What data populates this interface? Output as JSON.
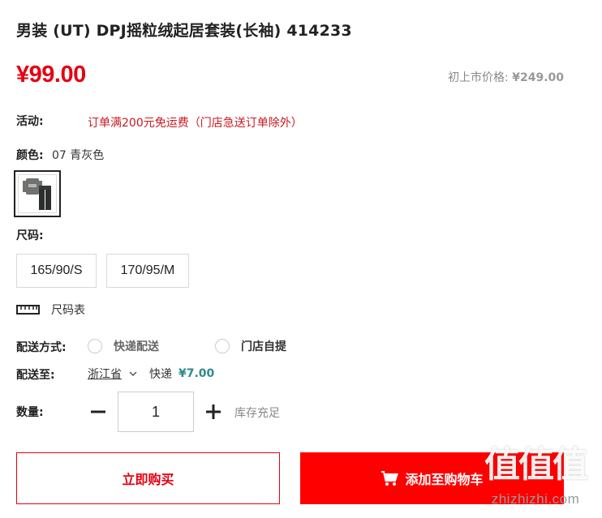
{
  "product": {
    "title": "男装 (UT) DPJ摇粒绒起居套装(长袖) 414233",
    "price": "¥99.00",
    "original_price_label": "初上市价格:",
    "original_price": "¥249.00"
  },
  "promotion": {
    "label": "活动:",
    "text": "订单满200元免运费（门店急送订单除外）"
  },
  "color": {
    "label": "颜色:",
    "selected": "07 青灰色",
    "swatch_icon": "pajama-set-thumbnail"
  },
  "size": {
    "label": "尺码:",
    "options": [
      "165/90/S",
      "170/95/M"
    ],
    "chart_label": "尺码表"
  },
  "delivery": {
    "method_label": "配送方式:",
    "options": [
      "快递配送",
      "门店自提"
    ],
    "to_label": "配送至:",
    "province": "浙江省",
    "courier": "快递",
    "fee": "¥7.00"
  },
  "quantity": {
    "label": "数量:",
    "value": "1",
    "stock_status": "库存充足"
  },
  "actions": {
    "buy_now": "立即购买",
    "add_to_cart": "添加至购物车"
  },
  "watermark": {
    "logo": "值值值",
    "url": "zhizhizhi.com"
  },
  "colors": {
    "price_red": "#e60012",
    "cart_button": "#ff0000",
    "promo_red": "#c9191f",
    "shipping_fee_teal": "#2e8a8c"
  }
}
